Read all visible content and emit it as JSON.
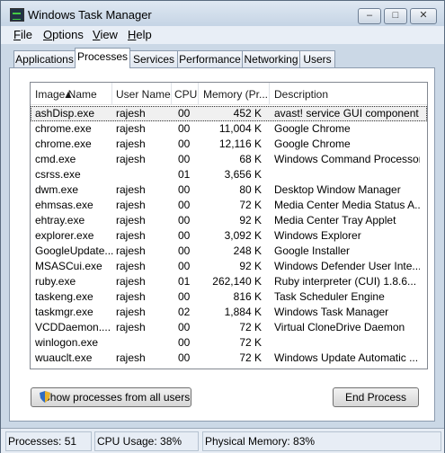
{
  "window": {
    "title": "Windows Task Manager",
    "controls": {
      "minimize": "–",
      "maximize": "□",
      "close": "✕"
    }
  },
  "menu": [
    "File",
    "Options",
    "View",
    "Help"
  ],
  "tabs": [
    "Applications",
    "Processes",
    "Services",
    "Performance",
    "Networking",
    "Users"
  ],
  "active_tab": "Processes",
  "columns": [
    "Image Name",
    "User Name",
    "CPU",
    "Memory (Pr...",
    "Description"
  ],
  "processes": [
    {
      "image": "ashDisp.exe",
      "user": "rajesh",
      "cpu": "00",
      "memory": "452 K",
      "description": "avast! service GUI component"
    },
    {
      "image": "chrome.exe",
      "user": "rajesh",
      "cpu": "00",
      "memory": "11,004 K",
      "description": "Google Chrome"
    },
    {
      "image": "chrome.exe",
      "user": "rajesh",
      "cpu": "00",
      "memory": "12,116 K",
      "description": "Google Chrome"
    },
    {
      "image": "cmd.exe",
      "user": "rajesh",
      "cpu": "00",
      "memory": "68 K",
      "description": "Windows Command Processor"
    },
    {
      "image": "csrss.exe",
      "user": "",
      "cpu": "01",
      "memory": "3,656 K",
      "description": ""
    },
    {
      "image": "dwm.exe",
      "user": "rajesh",
      "cpu": "00",
      "memory": "80 K",
      "description": "Desktop Window Manager"
    },
    {
      "image": "ehmsas.exe",
      "user": "rajesh",
      "cpu": "00",
      "memory": "72 K",
      "description": "Media Center Media Status A..."
    },
    {
      "image": "ehtray.exe",
      "user": "rajesh",
      "cpu": "00",
      "memory": "92 K",
      "description": "Media Center Tray Applet"
    },
    {
      "image": "explorer.exe",
      "user": "rajesh",
      "cpu": "00",
      "memory": "3,092 K",
      "description": "Windows Explorer"
    },
    {
      "image": "GoogleUpdate....",
      "user": "rajesh",
      "cpu": "00",
      "memory": "248 K",
      "description": "Google Installer"
    },
    {
      "image": "MSASCui.exe",
      "user": "rajesh",
      "cpu": "00",
      "memory": "92 K",
      "description": "Windows Defender User Inte..."
    },
    {
      "image": "ruby.exe",
      "user": "rajesh",
      "cpu": "01",
      "memory": "262,140 K",
      "description": "Ruby interpreter (CUI) 1.8.6..."
    },
    {
      "image": "taskeng.exe",
      "user": "rajesh",
      "cpu": "00",
      "memory": "816 K",
      "description": "Task Scheduler Engine"
    },
    {
      "image": "taskmgr.exe",
      "user": "rajesh",
      "cpu": "02",
      "memory": "1,884 K",
      "description": "Windows Task Manager"
    },
    {
      "image": "VCDDaemon....",
      "user": "rajesh",
      "cpu": "00",
      "memory": "72 K",
      "description": "Virtual CloneDrive Daemon"
    },
    {
      "image": "winlogon.exe",
      "user": "",
      "cpu": "00",
      "memory": "72 K",
      "description": ""
    },
    {
      "image": "wuauclt.exe",
      "user": "rajesh",
      "cpu": "00",
      "memory": "72 K",
      "description": "Windows Update Automatic ..."
    }
  ],
  "buttons": {
    "show_all": "Show processes from all users",
    "end_process": "End Process"
  },
  "status": {
    "processes": "Processes: 51",
    "cpu": "CPU Usage: 38%",
    "memory": "Physical Memory: 83%"
  },
  "icons": {
    "app": "task-manager-icon",
    "shield": "uac-shield-icon"
  }
}
